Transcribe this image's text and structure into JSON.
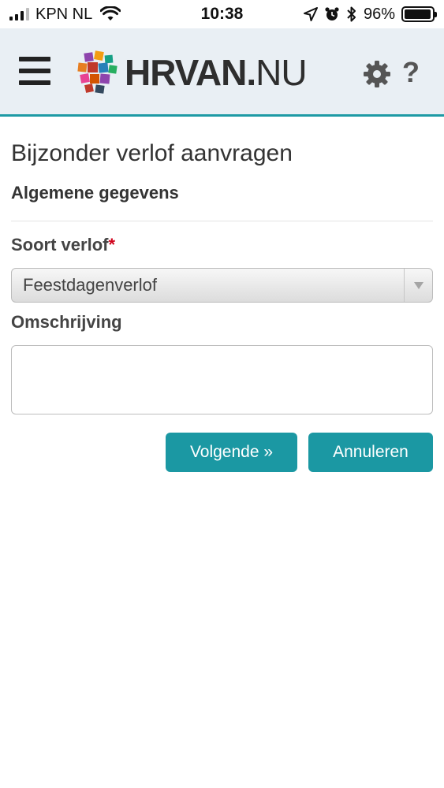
{
  "status_bar": {
    "carrier": "KPN NL",
    "time": "10:38",
    "battery_percent": "96%",
    "battery_level": 0.96,
    "icons": [
      "cellular-signal-icon",
      "wifi-icon",
      "location-arrow-icon",
      "alarm-icon",
      "bluetooth-icon",
      "battery-icon"
    ]
  },
  "header": {
    "menu_icon": "hamburger-menu-icon",
    "logo_bold": "HRVAN.",
    "logo_light": "NU",
    "settings_icon": "gear-icon",
    "help_label": "?"
  },
  "page": {
    "title": "Bijzonder verlof aanvragen",
    "section": "Algemene gegevens"
  },
  "form": {
    "leave_type": {
      "label": "Soort verlof",
      "required_mark": "*",
      "value": "Feestdagenverlof"
    },
    "description": {
      "label": "Omschrijving",
      "value": ""
    }
  },
  "actions": {
    "next_label": "Volgende »",
    "cancel_label": "Annuleren"
  },
  "colors": {
    "accent": "#1b98a3",
    "header_bg": "#e9eff4",
    "required": "#d0021b"
  }
}
